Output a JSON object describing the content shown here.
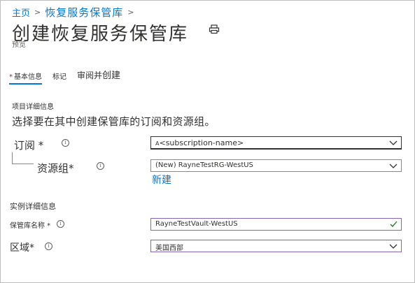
{
  "breadcrumb": {
    "home": "主页",
    "separator": ">",
    "current": "恢复服务保管库",
    "trailing_separator": ">"
  },
  "page": {
    "title": "创建恢复服务保管库",
    "preview": "预览"
  },
  "tabs": [
    {
      "required_mark": "*",
      "label": "基本信息",
      "active": true
    },
    {
      "label": "标记"
    },
    {
      "label_part1": "审阅并",
      "label_part2": "创建"
    }
  ],
  "project": {
    "heading": "项目详细信息",
    "description": "选择要在其中创建保管库的订阅和资源组。",
    "subscription": {
      "label": "订阅 *",
      "value": "<subscription-name>",
      "prefix": "A"
    },
    "resource_group": {
      "label": "资源组*",
      "value": "(New) RayneTestRG-WestUS",
      "create_new": "新建"
    }
  },
  "instance": {
    "heading": "实例详细信息",
    "vault_name": {
      "label": "保管库名称 *",
      "value": "RayneTestVault-WestUS"
    },
    "region": {
      "label": "区域*",
      "value": "美国西部"
    }
  },
  "icons": {
    "info": "info-icon",
    "chevron": "chevron-down-icon",
    "print": "print-icon",
    "check": "checkmark-icon"
  },
  "colors": {
    "accent": "#0078d4",
    "valid_border": "#8764b8",
    "check": "#107c10"
  }
}
